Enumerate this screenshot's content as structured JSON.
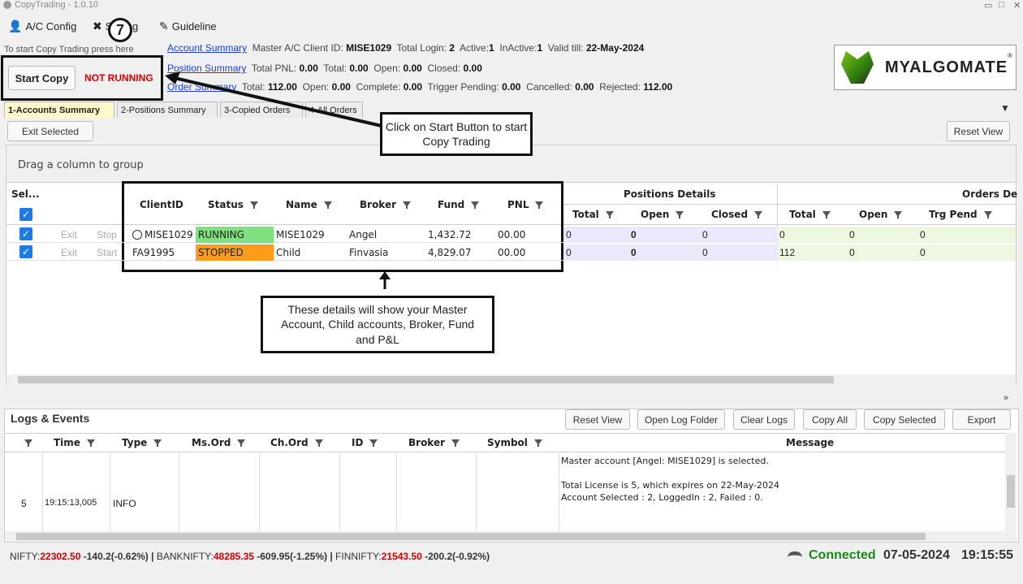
{
  "window": {
    "title": "CopyTrading - 1.0.10"
  },
  "menu": {
    "ac_config": "A/C Config",
    "setting": "Setting",
    "guideline": "Guideline",
    "step_number": "7"
  },
  "summary": {
    "start_hint": "To start Copy Trading press here",
    "account": {
      "link": "Account Summary",
      "master_label": "Master A/C Client ID:",
      "master_id": "MISE1029",
      "total_login_label": "Total Login:",
      "total_login": "2",
      "active_label": "Active:",
      "active": "1",
      "inactive_label": "InActive:",
      "inactive": "1",
      "valid_label": "Valid till:",
      "valid_till": "22-May-2024"
    },
    "position": {
      "link": "Position Summary",
      "pnl_label": "Total PNL:",
      "pnl": "0.00",
      "total_label": "Total:",
      "total": "0.00",
      "open_label": "Open:",
      "open": "0.00",
      "closed_label": "Closed:",
      "closed": "0.00"
    },
    "order": {
      "link": "Order Summary",
      "total_label": "Total:",
      "total": "112.00",
      "open_label": "Open:",
      "open": "0.00",
      "complete_label": "Complete:",
      "complete": "0.00",
      "trigger_label": "Trigger Pending:",
      "trigger": "0.00",
      "cancelled_label": "Cancelled:",
      "cancelled": "0.00",
      "rejected_label": "Rejected:",
      "rejected": "112.00"
    }
  },
  "start": {
    "button": "Start Copy",
    "status": "NOT RUNNING"
  },
  "logo": {
    "text": "MYALGOMATE",
    "mark": "®"
  },
  "tabs": [
    "1-Accounts Summary",
    "2-Positions Summary",
    "3-Copied Orders",
    "4-All Orders"
  ],
  "toolbar": {
    "exit_selected": "Exit Selected",
    "reset_view": "Reset View"
  },
  "grid": {
    "group_hint": "Drag a column to group",
    "headers": {
      "sel": "Sel...",
      "client_id": "ClientID",
      "status": "Status",
      "name": "Name",
      "broker": "Broker",
      "fund": "Fund",
      "pnl": "PNL",
      "positions_details": "Positions Details",
      "orders_details": "Orders De",
      "pos_total": "Total",
      "pos_open": "Open",
      "pos_closed": "Closed",
      "ord_total": "Total",
      "ord_open": "Open",
      "ord_trg": "Trg Pend"
    },
    "rows": [
      {
        "exit": "Exit",
        "action": "Stop",
        "client_id": "MISE1029",
        "status": "RUNNING",
        "name": "MISE1029",
        "broker": "Angel",
        "fund": "1,432.72",
        "pnl": "00.00",
        "pos_total": "0",
        "pos_open": "0",
        "pos_closed": "0",
        "ord_total": "0",
        "ord_open": "0",
        "ord_trg": "0"
      },
      {
        "exit": "Exit",
        "action": "Start",
        "client_id": "FA91995",
        "status": "STOPPED",
        "name": "Child",
        "broker": "Finvasia",
        "fund": "4,829.07",
        "pnl": "00.00",
        "pos_total": "0",
        "pos_open": "0",
        "pos_closed": "0",
        "ord_total": "112",
        "ord_open": "0",
        "ord_trg": "0"
      }
    ]
  },
  "callouts": {
    "start": "Click on Start Button to start Copy Trading",
    "details": "These details will show your Master Account, Child accounts, Broker, Fund and P&L"
  },
  "logs": {
    "title": "Logs & Events",
    "buttons": [
      "Reset View",
      "Open Log Folder",
      "Clear Logs",
      "Copy All",
      "Copy Selected",
      "Export"
    ],
    "headers": [
      "Time",
      "Type",
      "Ms.Ord",
      "Ch.Ord",
      "ID",
      "Broker",
      "Symbol",
      "Message"
    ],
    "row": {
      "num": "5",
      "time": "19:15:13,005",
      "type": "INFO",
      "messages": [
        "Master account [Angel: MISE1029] is selected.",
        "",
        "Total License is 5, which expires on 22-May-2024",
        "Account Selected : 2, LoggedIn : 2, Failed : 0."
      ]
    }
  },
  "status": {
    "nifty_label": "NIFTY:",
    "nifty": "22302.50",
    "nifty_chg": "-140.2(-0.62%)",
    "bank_label": "BANKNIFTY:",
    "bank": "48285.35",
    "bank_chg": "-609.95(-1.25%)",
    "fin_label": "FINNIFTY:",
    "fin": "21543.50",
    "fin_chg": "-200.2(-0.92%)",
    "connected": "Connected",
    "date": "07-05-2024",
    "time": "19:15:55"
  },
  "colors": {
    "running": "#7fe07f",
    "stopped": "#ff9a1a",
    "not_running": "#e00000",
    "link": "#1a3fd6",
    "check": "#1e7be3",
    "pos_bg": "#ece8fb",
    "ord_bg": "#eef8e0",
    "connected": "#1a8a1a",
    "index_red": "#d00000"
  }
}
